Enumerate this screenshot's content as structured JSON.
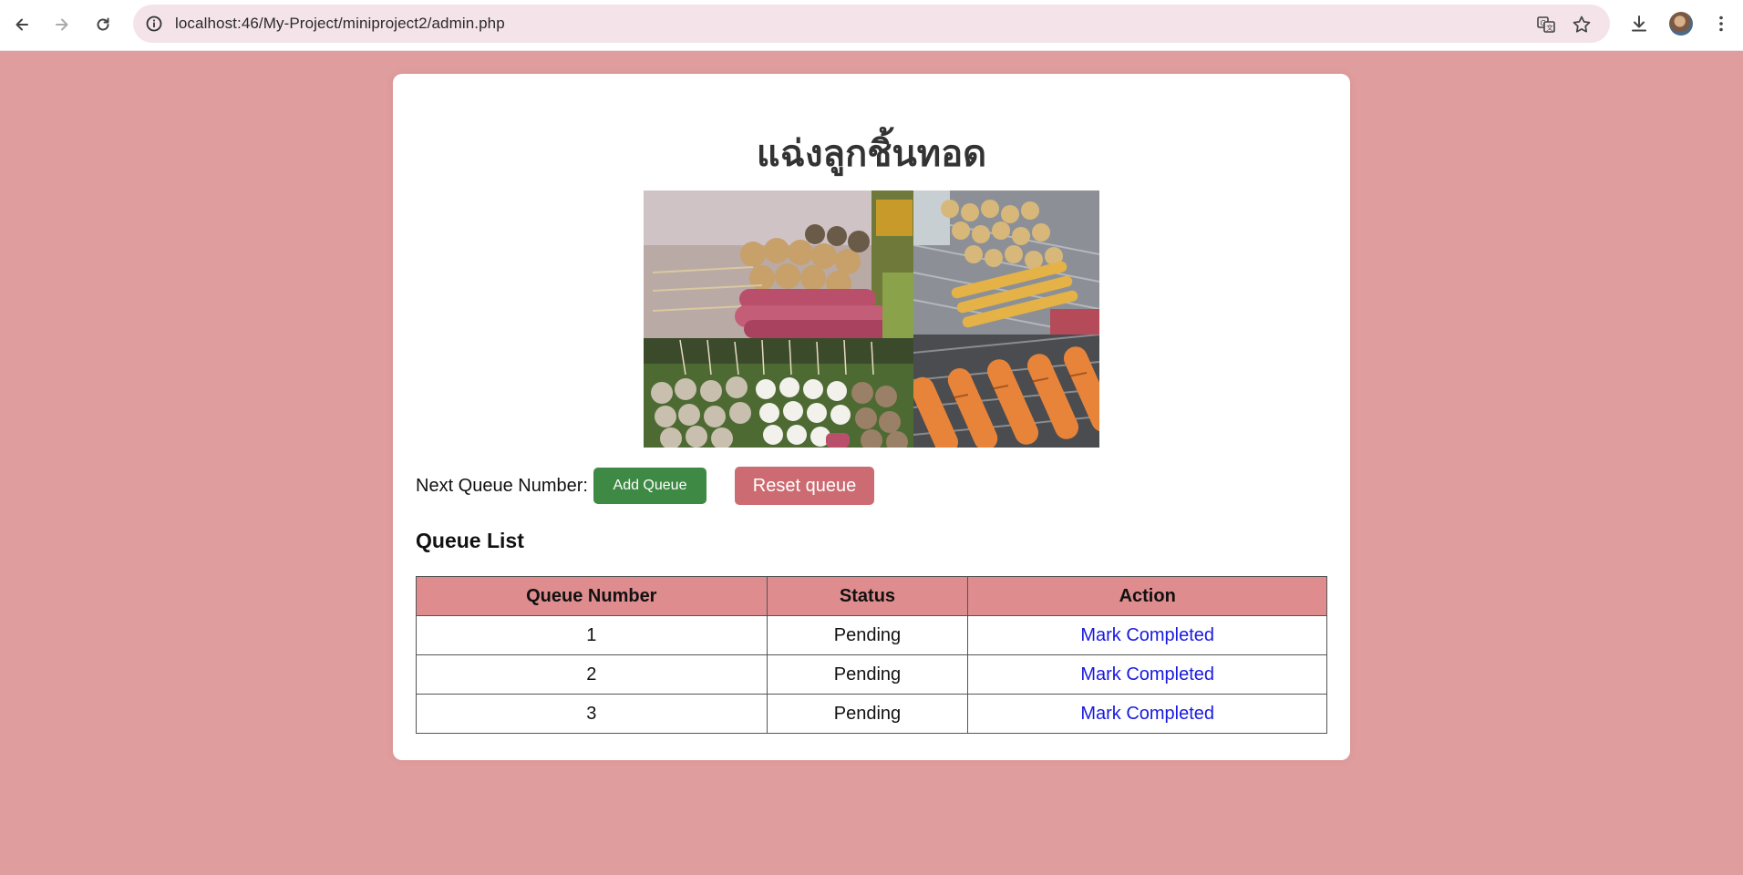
{
  "browser": {
    "url": "localhost:46/My-Project/miniproject2/admin.php",
    "icons": [
      "back-arrow-icon",
      "forward-arrow-icon",
      "reload-icon",
      "site-info-icon",
      "translate-icon",
      "bookmark-star-icon",
      "download-icon",
      "profile-avatar",
      "kebab-menu-icon"
    ]
  },
  "page": {
    "title": "แฉ่งลูกชิ้นทอด",
    "collage_subjects": [
      "sausages-and-meatballs-on-skewers",
      "fried-fishballs-and-sausages",
      "pork-balls-on-skewers",
      "grilled-sausages"
    ]
  },
  "queue": {
    "label": "Next Queue Number:",
    "add_button": "Add Queue",
    "reset_button": "Reset queue"
  },
  "queue_list": {
    "heading": "Queue List",
    "columns": [
      "Queue Number",
      "Status",
      "Action"
    ],
    "rows": [
      {
        "number": "1",
        "status": "Pending",
        "action": "Mark Completed"
      },
      {
        "number": "2",
        "status": "Pending",
        "action": "Mark Completed"
      },
      {
        "number": "3",
        "status": "Pending",
        "action": "Mark Completed"
      }
    ]
  },
  "colors": {
    "page_bg": "#e09d9d",
    "header_bg": "#de8c8e",
    "add_button": "#3e8a45",
    "reset_button": "#cc6c72",
    "link": "#1a1adf"
  }
}
